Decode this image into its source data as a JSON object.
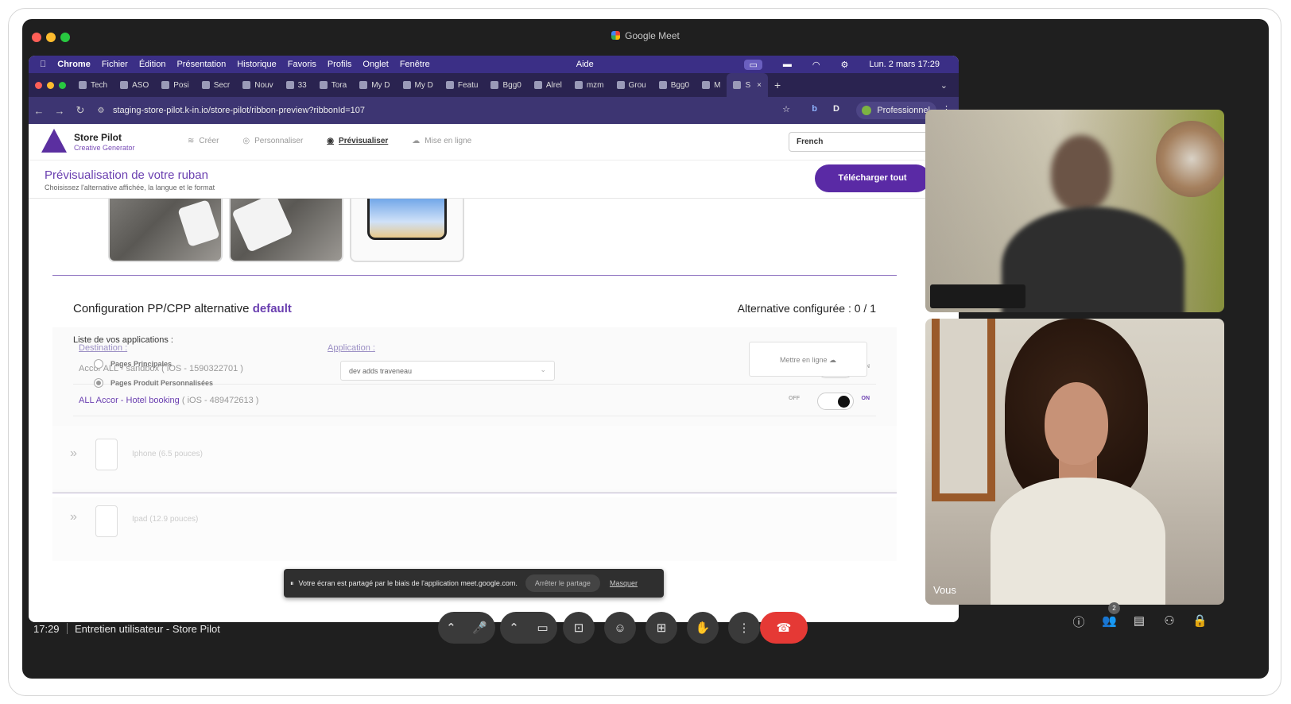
{
  "window": {
    "title": "Google Meet"
  },
  "mac_menu": {
    "items": [
      "Chrome",
      "Fichier",
      "Édition",
      "Présentation",
      "Historique",
      "Favoris",
      "Profils",
      "Onglet",
      "Fenêtre",
      "Aide"
    ],
    "clock": "Lun. 2 mars  17:29"
  },
  "browser": {
    "tabs": [
      "Tech",
      "ASO",
      "Posi",
      "Secr",
      "Nouv",
      "33",
      "Tora",
      "My D",
      "My D",
      "Featu",
      "Bgg0",
      "Alrel",
      "mzm",
      "Grou",
      "Bgg0",
      "M",
      "S"
    ],
    "url": "staging-store-pilot.k-in.io/store-pilot/ribbon-preview?ribbonId=107",
    "profile": "Professionnel"
  },
  "store_pilot": {
    "brand": "Store Pilot",
    "brand_sub": "Creative Generator",
    "steps": [
      "Créer",
      "Personnaliser",
      "Prévisualiser",
      "Mise en ligne"
    ],
    "language": "French",
    "preview_title": "Prévisualisation de votre ruban",
    "preview_subtitle": "Choisissez l'alternative affichée, la langue et le format",
    "download_button": "Télécharger tout",
    "config_title_prefix": "Configuration PP/CPP alternative",
    "config_title_value": "default",
    "config_status": "Alternative configurée : 0 / 1",
    "apps_list_title": "Liste de vos applications :",
    "apps": [
      {
        "name": "Accor ALL - sandbox",
        "meta": "( iOS - 1590322701 )",
        "on": false
      },
      {
        "name": "ALL Accor - Hotel booking",
        "meta": "( iOS - 489472613 )",
        "on": true
      }
    ],
    "toggle_off": "OFF",
    "toggle_on": "ON",
    "destination_label": "Destination :",
    "destinations": [
      "Pages Principales",
      "Pages Produit Personnalisées"
    ],
    "application_label": "Application :",
    "application_value": "dev adds traveneau",
    "online_button": "Mettre en ligne",
    "devices": [
      "Iphone (6.5 pouces)",
      "Ipad (12.9 pouces)"
    ]
  },
  "share_notice": {
    "text": "Votre écran est partagé par le biais de l'application meet.google.com.",
    "stop": "Arrêter le partage",
    "hide": "Masquer"
  },
  "meet": {
    "self_label": "Vous",
    "time": "17:29",
    "meeting_name": "Entretien utilisateur - Store Pilot",
    "participants_count": "2",
    "accent_end_call": "#e53935"
  }
}
